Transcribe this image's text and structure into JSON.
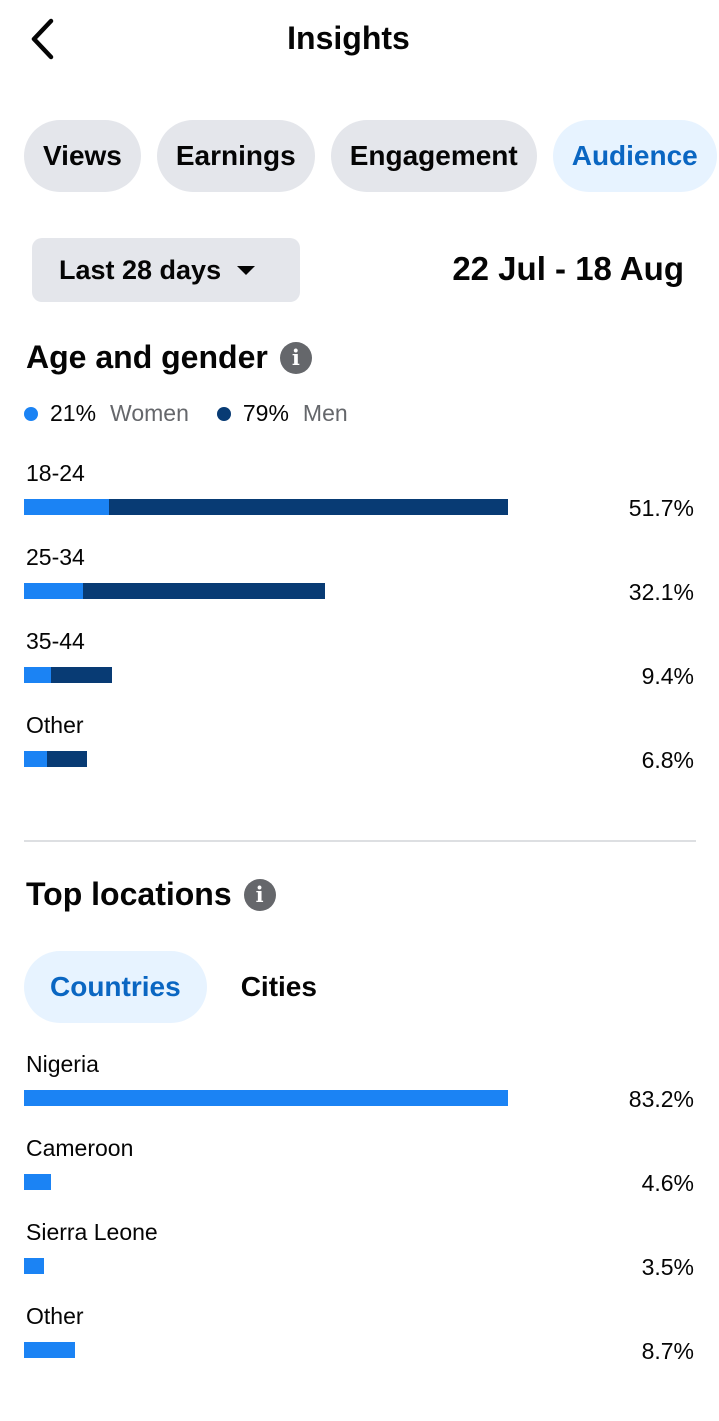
{
  "header": {
    "title": "Insights",
    "back_icon": "chevron-left-icon"
  },
  "tabs": [
    {
      "label": "Views",
      "active": false
    },
    {
      "label": "Earnings",
      "active": false
    },
    {
      "label": "Engagement",
      "active": false
    },
    {
      "label": "Audience",
      "active": true
    }
  ],
  "range": {
    "selected": "Last 28 days",
    "dates": "22 Jul - 18 Aug"
  },
  "age_gender": {
    "title": "Age and gender",
    "legend": [
      {
        "pct": "21%",
        "label": "Women",
        "color": "#1b83f4"
      },
      {
        "pct": "79%",
        "label": "Men",
        "color": "#083b74"
      }
    ],
    "rows": [
      {
        "label": "18-24",
        "value": "51.7%",
        "women_pct": 9.1,
        "men_pct": 42.6
      },
      {
        "label": "25-34",
        "value": "32.1%",
        "women_pct": 6.3,
        "men_pct": 25.8
      },
      {
        "label": "35-44",
        "value": "9.4%",
        "women_pct": 2.9,
        "men_pct": 6.5
      },
      {
        "label": "Other",
        "value": "6.8%",
        "women_pct": 2.5,
        "men_pct": 4.3
      }
    ]
  },
  "top_locations": {
    "title": "Top locations",
    "tabs": [
      {
        "label": "Countries",
        "active": true
      },
      {
        "label": "Cities",
        "active": false
      }
    ],
    "rows": [
      {
        "label": "Nigeria",
        "value": "83.2%",
        "pct": 83.2
      },
      {
        "label": "Cameroon",
        "value": "4.6%",
        "pct": 4.6
      },
      {
        "label": "Sierra Leone",
        "value": "3.5%",
        "pct": 3.5
      },
      {
        "label": "Other",
        "value": "8.7%",
        "pct": 8.7
      }
    ]
  },
  "colors": {
    "accent": "#0a66c2",
    "women": "#1b83f4",
    "men": "#083b74",
    "location_bar": "#1b83f4"
  }
}
